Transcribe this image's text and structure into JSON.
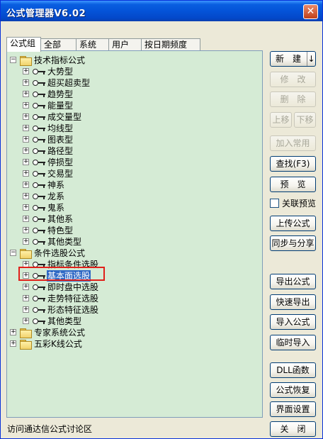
{
  "window": {
    "title": "公式管理器V6.02",
    "close_label": "✕"
  },
  "tabs": [
    {
      "label": "公式组",
      "active": true
    },
    {
      "label": "全部",
      "active": false
    },
    {
      "label": "系统",
      "active": false
    },
    {
      "label": "用户",
      "active": false
    },
    {
      "label": "按日期频度",
      "active": false
    }
  ],
  "tree": {
    "groups": [
      {
        "label": "技术指标公式",
        "expanded": true,
        "children": [
          "大势型",
          "超买超卖型",
          "趋势型",
          "能量型",
          "成交量型",
          "均线型",
          "图表型",
          "路径型",
          "停损型",
          "交易型",
          "神系",
          "龙系",
          "鬼系",
          "其他系",
          "特色型",
          "其他类型"
        ]
      },
      {
        "label": "条件选股公式",
        "expanded": true,
        "children": [
          "指标条件选股",
          "基本面选股",
          "即时盘中选股",
          "走势特征选股",
          "形态特征选股",
          "其他类型"
        ],
        "selected_child": "基本面选股"
      },
      {
        "label": "专家系统公式",
        "expanded": false,
        "children": []
      },
      {
        "label": "五彩K线公式",
        "expanded": false,
        "children": []
      }
    ]
  },
  "buttons": {
    "new": "新　建",
    "new_arrow": "↓",
    "modify": "修　改",
    "delete": "删　除",
    "move_up": "上移",
    "move_down": "下移",
    "add_common": "加入常用",
    "find": "查找(F3)",
    "preview": "预　览",
    "linked_preview": "关联预览",
    "upload": "上传公式",
    "sync_share": "同步与分享",
    "export": "导出公式",
    "quick_export": "快速导出",
    "import": "导入公式",
    "temp_import": "临时导入",
    "dll": "DLL函数",
    "restore": "公式恢复",
    "ui_settings": "界面设置",
    "close": "关　闭"
  },
  "status_link": "访问通达信公式讨论区",
  "colors": {
    "tree_background": "#d5ebd5",
    "selection": "#316ac5",
    "highlight_box": "#e0201a",
    "title_bar": "#0453d8"
  }
}
